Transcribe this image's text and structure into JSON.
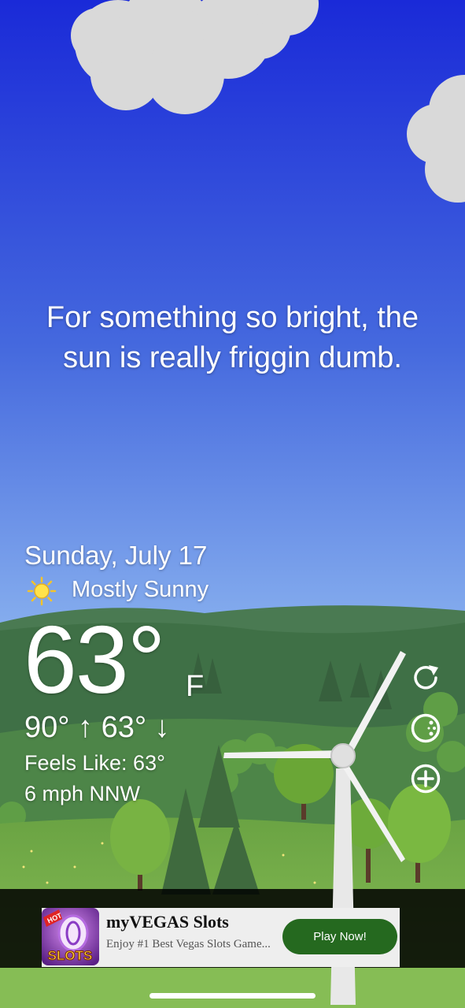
{
  "quote": {
    "line1": "For something so bright, the",
    "line2": "sun is really friggin dumb."
  },
  "weather": {
    "date": "Sunday, July 17",
    "condition": "Mostly Sunny",
    "condition_icon": "sun-icon",
    "temperature": "63°",
    "unit": "F",
    "hi_lo": "90° ↑  63° ↓",
    "feels_like": "Feels Like: 63°",
    "wind": "6 mph NNW"
  },
  "controls": {
    "refresh_icon": "refresh-icon",
    "scene_icon": "scene-toggle-icon",
    "add_icon": "add-location-icon"
  },
  "ad": {
    "app_icon": "myvegas-slots-app-icon",
    "icon_text_top": "HOT",
    "icon_text_bottom": "SLOTS",
    "title": "myVEGAS Slots",
    "description": "Enjoy #1 Best Vegas Slots Game...",
    "button_label": "Play Now!"
  },
  "colors": {
    "sky_top": "#1a2ad8",
    "sky_bottom": "#7ba6ec",
    "hills": "#3f7046",
    "grass": "#75b24a",
    "ad_button": "#25691f"
  }
}
